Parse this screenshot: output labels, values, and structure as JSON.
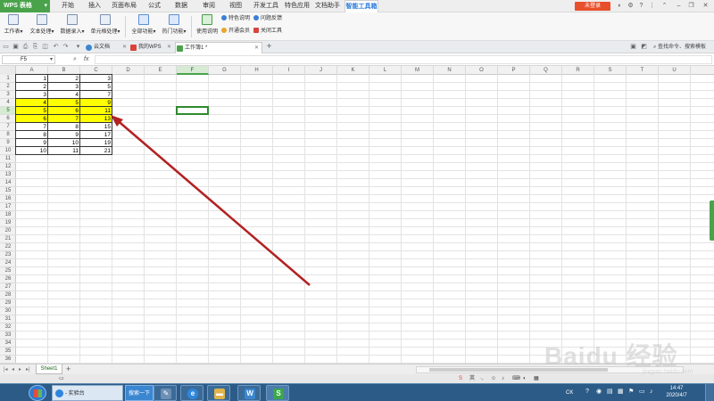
{
  "app": {
    "name": "WPS 表格"
  },
  "menu": {
    "tabs": [
      "开始",
      "插入",
      "页面布局",
      "公式",
      "数据",
      "审阅",
      "视图",
      "开发工具",
      "特色应用",
      "文档助手",
      "智能工具箱"
    ],
    "active_tab": "智能工具箱",
    "login_label": "未登录"
  },
  "ribbon": {
    "groups": [
      "工作表",
      "文本处理",
      "数据录入",
      "单元格处理"
    ],
    "features": [
      "全部功能",
      "热门功能"
    ],
    "usage_label": "使用说明",
    "links": {
      "feature_intro": "特色说明",
      "feedback": "问题反馈",
      "open_member": "开通会员",
      "close_tools": "关闭工具"
    }
  },
  "doc_tabs": {
    "items": [
      {
        "label": "云文档"
      },
      {
        "label": "我的WPS"
      },
      {
        "label": "工作簿1 *"
      }
    ],
    "search_placeholder": "查找命令、搜索模板"
  },
  "formula_bar": {
    "name_box": "F5",
    "fx": "fx",
    "value": ""
  },
  "grid": {
    "columns": [
      "A",
      "B",
      "C",
      "D",
      "E",
      "F",
      "G",
      "H",
      "I",
      "J",
      "K",
      "L",
      "M",
      "N",
      "O",
      "P",
      "Q",
      "R",
      "S",
      "T",
      "U"
    ],
    "selected_column": "F",
    "selected_row": 5,
    "row_count": 36,
    "highlight_color": "#ffff00",
    "data": [
      [
        1,
        2,
        3
      ],
      [
        2,
        3,
        5
      ],
      [
        3,
        4,
        7
      ],
      [
        4,
        5,
        9
      ],
      [
        5,
        6,
        11
      ],
      [
        6,
        7,
        13
      ],
      [
        7,
        8,
        15
      ],
      [
        8,
        9,
        17
      ],
      [
        9,
        10,
        19
      ],
      [
        10,
        11,
        21
      ]
    ],
    "highlighted_rows": [
      4,
      5,
      6
    ],
    "annotation_color": "#b22222"
  },
  "sheets": {
    "items": [
      "Sheet1"
    ],
    "add_label": "+"
  },
  "taskbar": {
    "ie_label": "- 实验台",
    "search_label": "搜索一下",
    "wps_glyph": "W",
    "et_glyph": "S",
    "ime": "CK",
    "time": "14:47",
    "date": "2020/4/7"
  },
  "watermark": {
    "text": "Baidu 经验",
    "sub": "jingyan.baidu.com"
  }
}
